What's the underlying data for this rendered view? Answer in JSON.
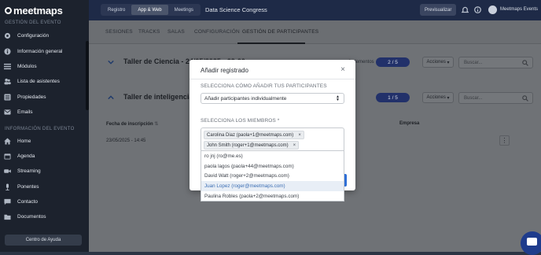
{
  "brand": {
    "name": "meetmaps"
  },
  "sidebar": {
    "section_event_mgmt": "GESTIÓN DEL EVENTO",
    "items": [
      {
        "label": "Configuración",
        "icon": "gear-icon"
      },
      {
        "label": "Información general",
        "icon": "info-icon"
      },
      {
        "label": "Módulos",
        "icon": "modules-icon"
      },
      {
        "label": "Lista de asistentes",
        "icon": "users-icon"
      },
      {
        "label": "Propiedades",
        "icon": "properties-icon"
      },
      {
        "label": "Emails",
        "icon": "mail-icon"
      }
    ],
    "section_event_info": "INFORMACIÓN DEL EVENTO",
    "info_items": [
      {
        "label": "Home",
        "icon": "home-icon"
      },
      {
        "label": "Agenda",
        "icon": "calendar-icon"
      },
      {
        "label": "Streaming",
        "icon": "video-icon"
      },
      {
        "label": "Ponentes",
        "icon": "microphone-icon"
      },
      {
        "label": "Contacto",
        "icon": "chat-icon"
      },
      {
        "label": "Documentos",
        "icon": "folder-icon"
      }
    ],
    "help_button": "Centro de Ayuda"
  },
  "topbar": {
    "segments": [
      "Registro",
      "App & Web",
      "Meetings"
    ],
    "active_segment": "App & Web",
    "event_title": "Data Science Congress",
    "preview_button": "Previsualizar",
    "user_name": "Meetmaps Events"
  },
  "tabs": [
    "SESIONES",
    "TRACKS",
    "SALAS",
    "CONFIGURACIÓN",
    "GESTIÓN DE PARTICIPANTES"
  ],
  "active_tab": "GESTIÓN DE PARTICIPANTES",
  "sessions": [
    {
      "title": "Taller de Ciencia - 24/05/2025 - 09:00",
      "count_text": "2 elementos",
      "badge": "2 / 5",
      "actions": "Acciones",
      "search_placeholder": "Buscar..."
    },
    {
      "title": "Taller de inteligencia art",
      "badge": "1 / 5",
      "actions": "Acciones",
      "search_placeholder": "Buscar..."
    }
  ],
  "table": {
    "col_date": "Fecha de inscripción",
    "col_company": "Empresa",
    "rows": [
      {
        "date": "23/05/2025 - 14:45"
      }
    ]
  },
  "modal": {
    "title": "Añadir registrado",
    "close": "×",
    "how_label": "SELECCIONA CÓMO AÑADIR TUS PARTICIPANTES",
    "how_value": "Añadir participantes individualmente",
    "members_label": "SELECCIONA LOS MIEMBROS *",
    "selected": [
      {
        "label": "Carolina Diaz (paola+1@meetmaps.com)",
        "remove": "×"
      },
      {
        "label": "John Smith (roger+1@meetmaps.com)",
        "remove": "×"
      }
    ],
    "options": [
      "ro jnj (ro@me.es)",
      "paola lagos (paola+44@meetmaps.com)",
      "David Watt (roger+2@meetmaps.com)",
      "Juan Lopez (roger@meetmaps.com)",
      "Paulina Robles (paola+2@meetmaps.com)"
    ],
    "highlighted_option_index": 3
  },
  "colors": {
    "accent": "#22316a",
    "highlight": "#3d6fb4",
    "sidebar_bg": "#1c222d",
    "topbar_bg": "#1e2a47"
  }
}
